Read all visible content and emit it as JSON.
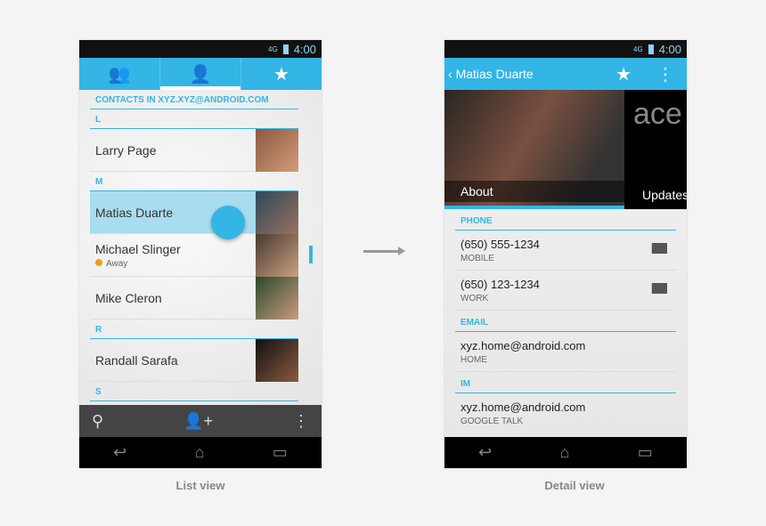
{
  "status": {
    "time": "4:00",
    "network": "4G"
  },
  "list": {
    "tabs": [
      {
        "icon": "groups-icon",
        "label": "Groups"
      },
      {
        "icon": "person-icon",
        "label": "All"
      },
      {
        "icon": "star-icon",
        "label": "Favorites"
      }
    ],
    "account_header": "CONTACTS IN XYZ.XYZ@ANDROID.COM",
    "sections": [
      {
        "letter": "L",
        "contacts": [
          {
            "name": "Larry Page"
          }
        ]
      },
      {
        "letter": "M",
        "contacts": [
          {
            "name": "Matias Duarte",
            "selected": true
          },
          {
            "name": "Michael Slinger",
            "status": "Away"
          },
          {
            "name": "Mike Cleron"
          }
        ]
      },
      {
        "letter": "R",
        "contacts": [
          {
            "name": "Randall Sarafa"
          }
        ]
      },
      {
        "letter": "S",
        "contacts": []
      }
    ],
    "caption": "List view"
  },
  "detail": {
    "title": "Matias Duarte",
    "tabs": [
      "About",
      "Updates"
    ],
    "updates_text": "ace",
    "phone_header": "PHONE",
    "phones": [
      {
        "number": "(650) 555-1234",
        "type": "MOBILE"
      },
      {
        "number": "(650) 123-1234",
        "type": "WORK"
      }
    ],
    "email_header": "EMAIL",
    "email": {
      "value": "xyz.home@android.com",
      "type": "HOME"
    },
    "im_header": "IM",
    "im": {
      "value": "xyz.home@android.com",
      "type": "GOOGLE TALK"
    },
    "caption": "Detail view"
  },
  "colors": {
    "accent": "#33b5e5",
    "away": "#f39c12"
  }
}
